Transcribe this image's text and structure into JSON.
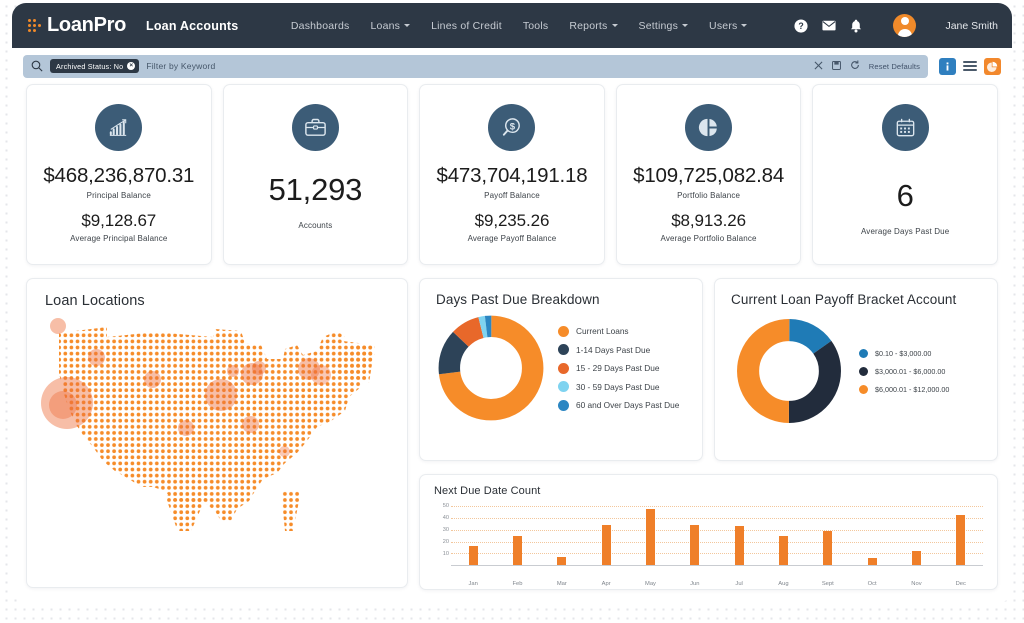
{
  "nav": {
    "logo_text": "LoanPro",
    "page_title": "Loan Accounts",
    "links": [
      {
        "label": "Dashboards",
        "caret": false
      },
      {
        "label": "Loans",
        "caret": true
      },
      {
        "label": "Lines of Credit",
        "caret": false
      },
      {
        "label": "Tools",
        "caret": false
      },
      {
        "label": "Reports",
        "caret": true
      },
      {
        "label": "Settings",
        "caret": true
      },
      {
        "label": "Users",
        "caret": true
      }
    ],
    "icons": [
      "help-icon",
      "mail-icon",
      "bell-icon"
    ],
    "user_name": "Jane Smith"
  },
  "filter": {
    "chip_label": "Archived Status: No",
    "placeholder": "Filter by Keyword",
    "reset_label": "Reset Defaults",
    "clear_icon": "close-icon",
    "save_icon": "save-icon",
    "refresh_icon": "refresh-icon",
    "info_button": "info-icon",
    "list_button": "list-icon",
    "chart_button": "pie-chart-icon"
  },
  "kpis": [
    {
      "icon": "bar-chart-growth-icon",
      "primary_value": "$468,236,870.31",
      "primary_label": "Principal Balance",
      "secondary_value": "$9,128.67",
      "secondary_label": "Average Principal Balance"
    },
    {
      "icon": "briefcase-icon",
      "primary_value": "51,293",
      "primary_label": "Accounts",
      "secondary_value": "",
      "secondary_label": ""
    },
    {
      "icon": "dollar-magnifier-icon",
      "primary_value": "$473,704,191.18",
      "primary_label": "Payoff Balance",
      "secondary_value": "$9,235.26",
      "secondary_label": "Average Payoff Balance"
    },
    {
      "icon": "pie-chart-icon",
      "primary_value": "$109,725,082.84",
      "primary_label": "Portfolio Balance",
      "secondary_value": "$8,913.26",
      "secondary_label": "Average Portfolio Balance"
    },
    {
      "icon": "calendar-icon",
      "primary_value": "6",
      "primary_label": "Average Days Past Due",
      "secondary_value": "",
      "secondary_label": ""
    }
  ],
  "map": {
    "title": "Loan Locations"
  },
  "colors": {
    "orange": "#F68C29",
    "navy": "#2D3C50",
    "dark_navy": "#222C3C",
    "orange_dark": "#E8682A",
    "light_blue": "#7FD3F0",
    "blue": "#2C86C2",
    "nav_bg": "#2D3845"
  },
  "chart_data": [
    {
      "type": "pie",
      "title": "Days Past Due Breakdown",
      "legend_position": "right",
      "labels": [
        "Current Loans",
        "1-14 Days Past Due",
        "15 - 29 Days Past Due",
        "30 - 59 Days Past Due",
        "60 and Over Days Past Due"
      ],
      "values": [
        73,
        14,
        9,
        2,
        2
      ],
      "colors": [
        "#F68C29",
        "#2D4358",
        "#E8682A",
        "#7FD3F0",
        "#2C86C2"
      ]
    },
    {
      "type": "pie",
      "title": "Current Loan Payoff Bracket Account",
      "legend_position": "right",
      "labels": [
        "$0.10 - $3,000.00",
        "$3,000.01 - $6,000.00",
        "$6,000.01 - $12,000.00"
      ],
      "values": [
        15,
        35,
        50
      ],
      "colors": [
        "#1F7BB6",
        "#222C3C",
        "#F68C29"
      ]
    },
    {
      "type": "bar",
      "title": "Next Due Date Count",
      "categories": [
        "Jan",
        "Feb",
        "Mar",
        "Apr",
        "May",
        "Jun",
        "Jul",
        "Aug",
        "Sept",
        "Oct",
        "Nov",
        "Dec"
      ],
      "values": [
        16,
        25,
        7,
        34,
        48,
        34,
        33,
        25,
        29,
        6,
        12,
        43
      ],
      "yticks": [
        10,
        20,
        30,
        40,
        50
      ],
      "ylim": [
        0,
        52
      ],
      "xlabel": "",
      "ylabel": "",
      "grid": true,
      "bar_color": "#EF7F29"
    }
  ]
}
